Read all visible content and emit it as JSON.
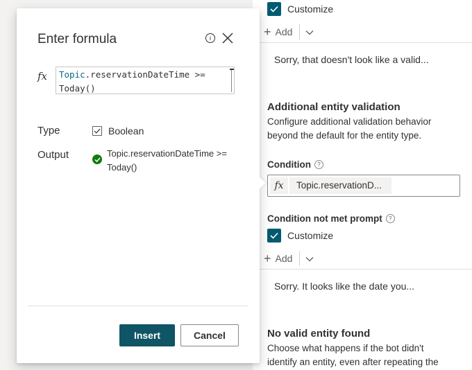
{
  "dialog": {
    "title": "Enter formula",
    "info_icon_glyph": "i",
    "fx_symbol": "fx",
    "formula": {
      "keyword": "Topic",
      "line1_rest": ".reservationDateTime >=",
      "line2": "Today()"
    },
    "type_label": "Type",
    "type_value": "Boolean",
    "output_label": "Output",
    "output_value": "Topic.reservationDateTime >= Today()",
    "insert_label": "Insert",
    "cancel_label": "Cancel"
  },
  "panel": {
    "top_customize_label": "Customize",
    "top_add_label": "Add",
    "top_message": "Sorry, that doesn't look like a valid...",
    "validation_title": "Additional entity validation",
    "validation_desc": "Configure additional validation behavior beyond the default for the entity type.",
    "condition_label": "Condition",
    "condition_fx": "fx",
    "condition_value": "Topic.reservationD...",
    "not_met_label": "Condition not met prompt",
    "bottom_customize_label": "Customize",
    "bottom_add_label": "Add",
    "bottom_message": "Sorry. It looks like the date you...",
    "no_entity_title": "No valid entity found",
    "no_entity_desc": "Choose what happens if the bot didn't identify an entity, even after repeating the",
    "help_glyph": "?"
  },
  "icons": {
    "info": "info-icon",
    "close": "close-icon",
    "check": "checkmark-icon",
    "success": "success-check-icon",
    "plus": "plus-icon",
    "chevron": "chevron-down-icon",
    "help": "help-icon"
  },
  "colors": {
    "accent": "#005b70",
    "insert_button": "#0f5566",
    "success": "#107c10",
    "formula_keyword": "#0b6a80"
  }
}
